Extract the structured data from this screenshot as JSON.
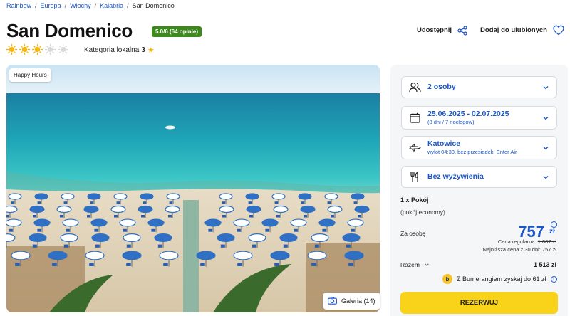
{
  "breadcrumb": [
    "Rainbow",
    "Europa",
    "Włochy",
    "Kalabria",
    "San Domenico"
  ],
  "hotel": {
    "name": "San Domenico",
    "rating": "5.0/6 (64 opinie)",
    "suns_filled": 3,
    "suns_total": 5,
    "category_label": "Kategoria lokalna",
    "category_value": "3"
  },
  "actions": {
    "share": "Udostępnij",
    "favorite": "Dodaj do ulubionych"
  },
  "hero": {
    "badge": "Happy Hours",
    "gallery": "Galeria (14)"
  },
  "booking": {
    "guests": "2 osoby",
    "dates": "25.06.2025 - 02.07.2025",
    "nights": "(8 dni / 7 noclegów)",
    "departure_city": "Katowice",
    "flight_info": "wylot 04:30, bez przesiadek, Enter Air",
    "board": "Bez wyżywienia",
    "room_count": "1 x Pokój",
    "room_type": "(pokój economy)",
    "per_person_label": "Za osobę",
    "price": "757",
    "currency": "zł",
    "regular_label": "Cena regularna:",
    "regular_price": "1 007 zł",
    "lowest_label": "Najniższa cena z 30 dni: 757 zł",
    "total_label": "Razem",
    "total_value": "1 513 zł",
    "bumerang": "Z Bumerangiem zyskaj do 61 zł",
    "reserve": "REZERWUJ"
  },
  "colors": {
    "accent": "#1a56c8",
    "rating_green": "#3b8a1a",
    "sun": "#f5b40a",
    "reserve": "#f8d31a"
  }
}
